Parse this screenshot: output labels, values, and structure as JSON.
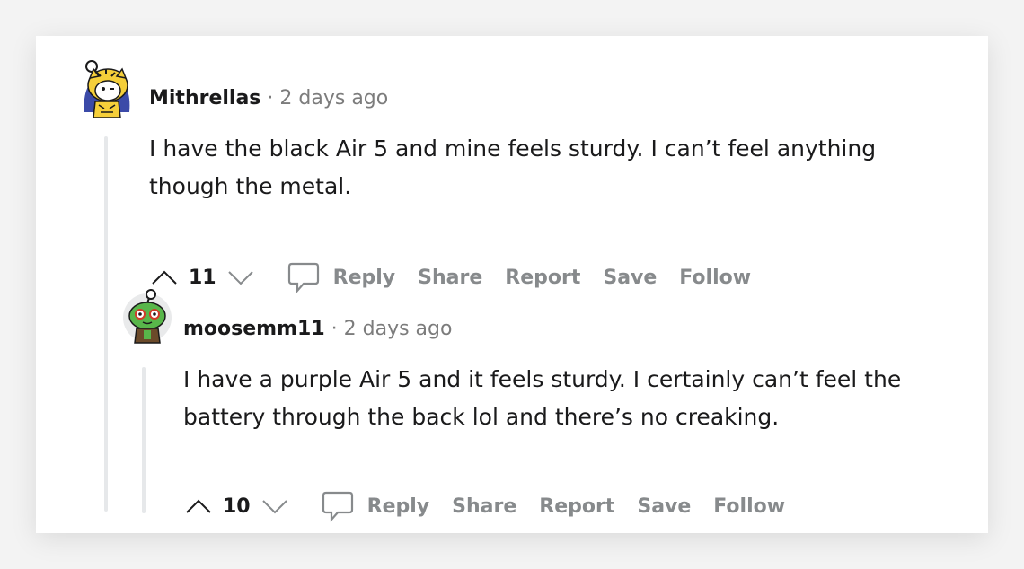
{
  "comments": [
    {
      "username": "Mithrellas",
      "separator": "·",
      "time": "2 days ago",
      "body": "I have the black Air 5 and mine feels sturdy. I can’t feel anything though the metal.",
      "score": "11",
      "actions": {
        "reply": "Reply",
        "share": "Share",
        "report": "Report",
        "save": "Save",
        "follow": "Follow"
      }
    },
    {
      "username": "moosemm11",
      "separator": "·",
      "time": "2 days ago",
      "body": "I have a purple Air 5 and it feels sturdy. I certainly can’t feel the battery through the back lol and there’s no creaking.",
      "score": "10",
      "actions": {
        "reply": "Reply",
        "share": "Share",
        "report": "Report",
        "save": "Save",
        "follow": "Follow"
      }
    }
  ],
  "colors": {
    "text": "#1a1a1b",
    "muted": "#878a8c",
    "thread_line": "#e6e8ea",
    "avatar1_fur": "#f5cf3a",
    "avatar2_body": "#58b64a"
  },
  "icons": [
    "upvote-icon",
    "downvote-icon",
    "reply-bubble-icon"
  ]
}
